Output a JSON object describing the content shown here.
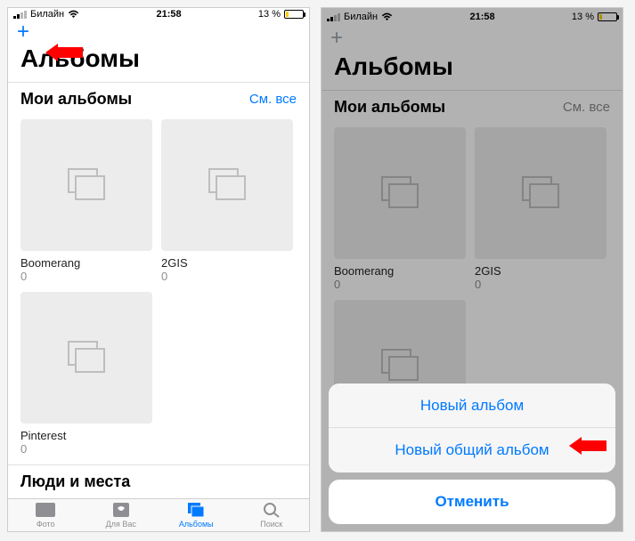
{
  "status": {
    "carrier": "Билайн",
    "time": "21:58",
    "battery_text": "13 %"
  },
  "left": {
    "title": "Альбомы",
    "section_my_albums": "Мои альбомы",
    "see_all": "См. все",
    "albums": [
      {
        "name": "Boomerang",
        "count": "0"
      },
      {
        "name": "2GIS",
        "count": "0"
      },
      {
        "name": "Pinterest",
        "count": "0"
      }
    ],
    "section_people_places": "Люди и места",
    "tabs": {
      "photos": "Фото",
      "for_you": "Для Вас",
      "albums": "Альбомы",
      "search": "Поиск"
    }
  },
  "right": {
    "title": "Альбомы",
    "section_my_albums": "Мои альбомы",
    "see_all": "См. все",
    "albums": [
      {
        "name": "Boomerang",
        "count": "0"
      },
      {
        "name": "2GIS",
        "count": "0"
      }
    ],
    "sheet": {
      "new_album": "Новый альбом",
      "new_shared_album": "Новый общий альбом",
      "cancel": "Отменить"
    }
  }
}
